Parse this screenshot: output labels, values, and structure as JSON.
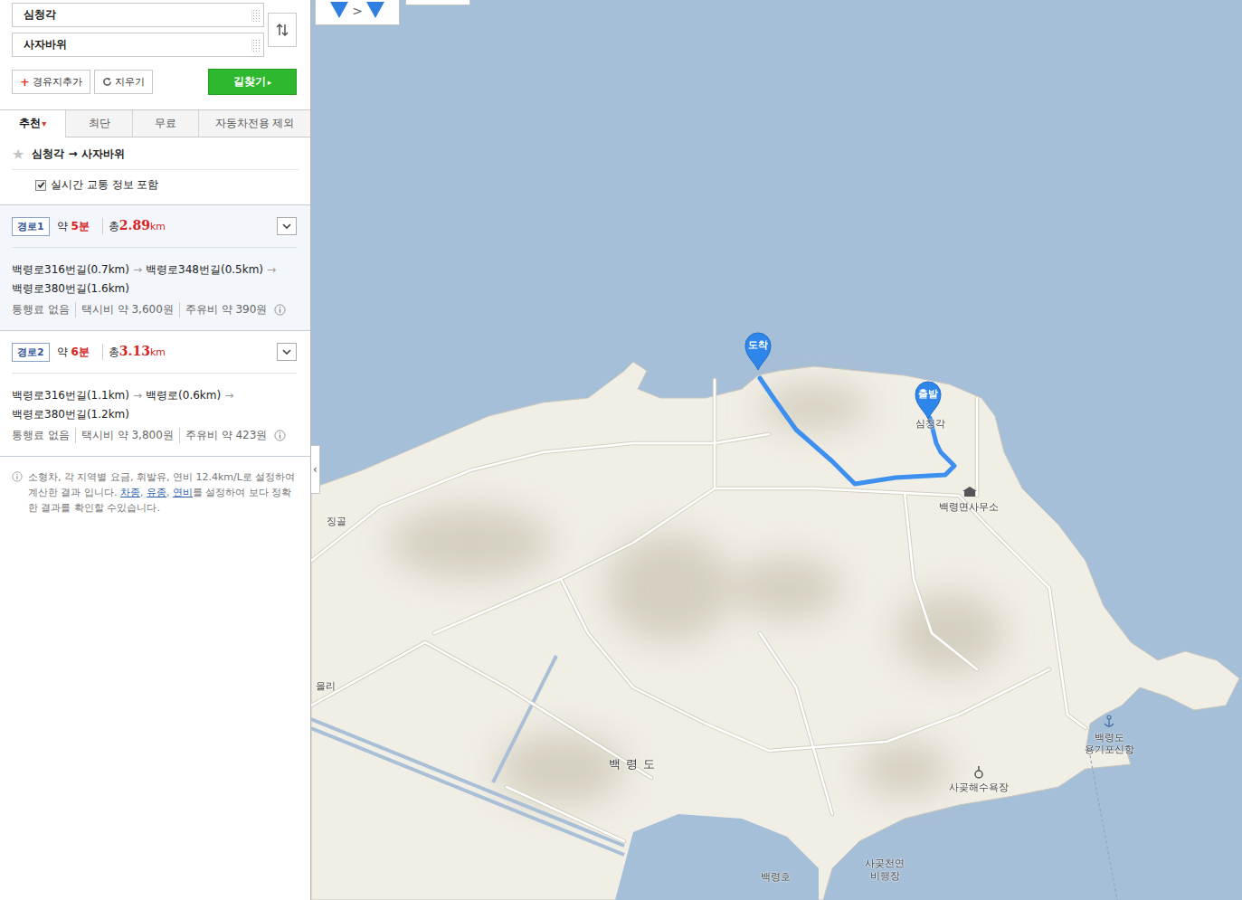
{
  "search": {
    "origin": "심청각",
    "destination": "사자바위"
  },
  "add_waypoint": {
    "icon": "+",
    "label": "경유지추가"
  },
  "clear": {
    "label": "지우기"
  },
  "search_button": {
    "label": "길찾기",
    "icon": "▸"
  },
  "tabs": [
    {
      "label": "추천",
      "selected": true,
      "caret": "▾"
    },
    {
      "label": "최단",
      "selected": false
    },
    {
      "label": "무료",
      "selected": false
    },
    {
      "label": "자동차전용 제외",
      "selected": false
    }
  ],
  "summary": {
    "star": "★",
    "favorite": false,
    "title": "심청각 → 사자바위"
  },
  "traffic": {
    "label": "실시간 교통 정보 포함",
    "checked": true
  },
  "step_separator": "→",
  "routes": [
    {
      "name": "경로1",
      "selected": true,
      "expanded": false,
      "time_prefix": "약",
      "time": "5분",
      "dist_prefix": "총",
      "distance": "2.89",
      "unit": "km",
      "steps": [
        "백령로316번길(0.7km)",
        "백령로348번길(0.5km)",
        "백령로380번길(1.6km)"
      ],
      "info": [
        "통행료 없음",
        "택시비 약 3,600원",
        "주유비 약 390원"
      ]
    },
    {
      "name": "경로2",
      "selected": false,
      "expanded": false,
      "time_prefix": "약",
      "time": "6분",
      "dist_prefix": "총",
      "distance": "3.13",
      "unit": "km",
      "steps": [
        "백령로316번길(1.1km)",
        "백령로(0.6km)",
        "백령로380번길(1.2km)"
      ],
      "info": [
        "통행료 없음",
        "택시비 약 3,800원",
        "주유비 약 423원"
      ]
    }
  ],
  "note": {
    "parts": [
      {
        "text": "소형차, 각 지역별 요금, 휘발유, 연비 12.4km/L로 설정하여 계산한 결과 입니다. ",
        "link": false
      },
      {
        "text": "차종",
        "link": true
      },
      {
        "text": ", ",
        "link": false
      },
      {
        "text": "유종",
        "link": true
      },
      {
        "text": ", ",
        "link": false
      },
      {
        "text": "연비",
        "link": true
      },
      {
        "text": "를 설정하여 보다 정확한 결과를 확인할 수있습니다.",
        "link": false
      }
    ]
  },
  "panel_toggle": "‹",
  "map": {
    "mini_route": {
      "separator": ">"
    },
    "pins": [
      {
        "label": "도착",
        "kind": "destination"
      },
      {
        "label": "출발",
        "kind": "origin"
      }
    ],
    "labels": [
      {
        "text": "심청각"
      },
      {
        "text": "백령면사무소"
      },
      {
        "text": "징골"
      },
      {
        "text": "을리"
      },
      {
        "text": "백령도"
      },
      {
        "text": "백령도"
      },
      {
        "text": "용기포신항"
      },
      {
        "text": "사곶해수욕장"
      },
      {
        "text": "사곶천연"
      },
      {
        "text": "비행장"
      },
      {
        "text": "백령호"
      }
    ]
  }
}
